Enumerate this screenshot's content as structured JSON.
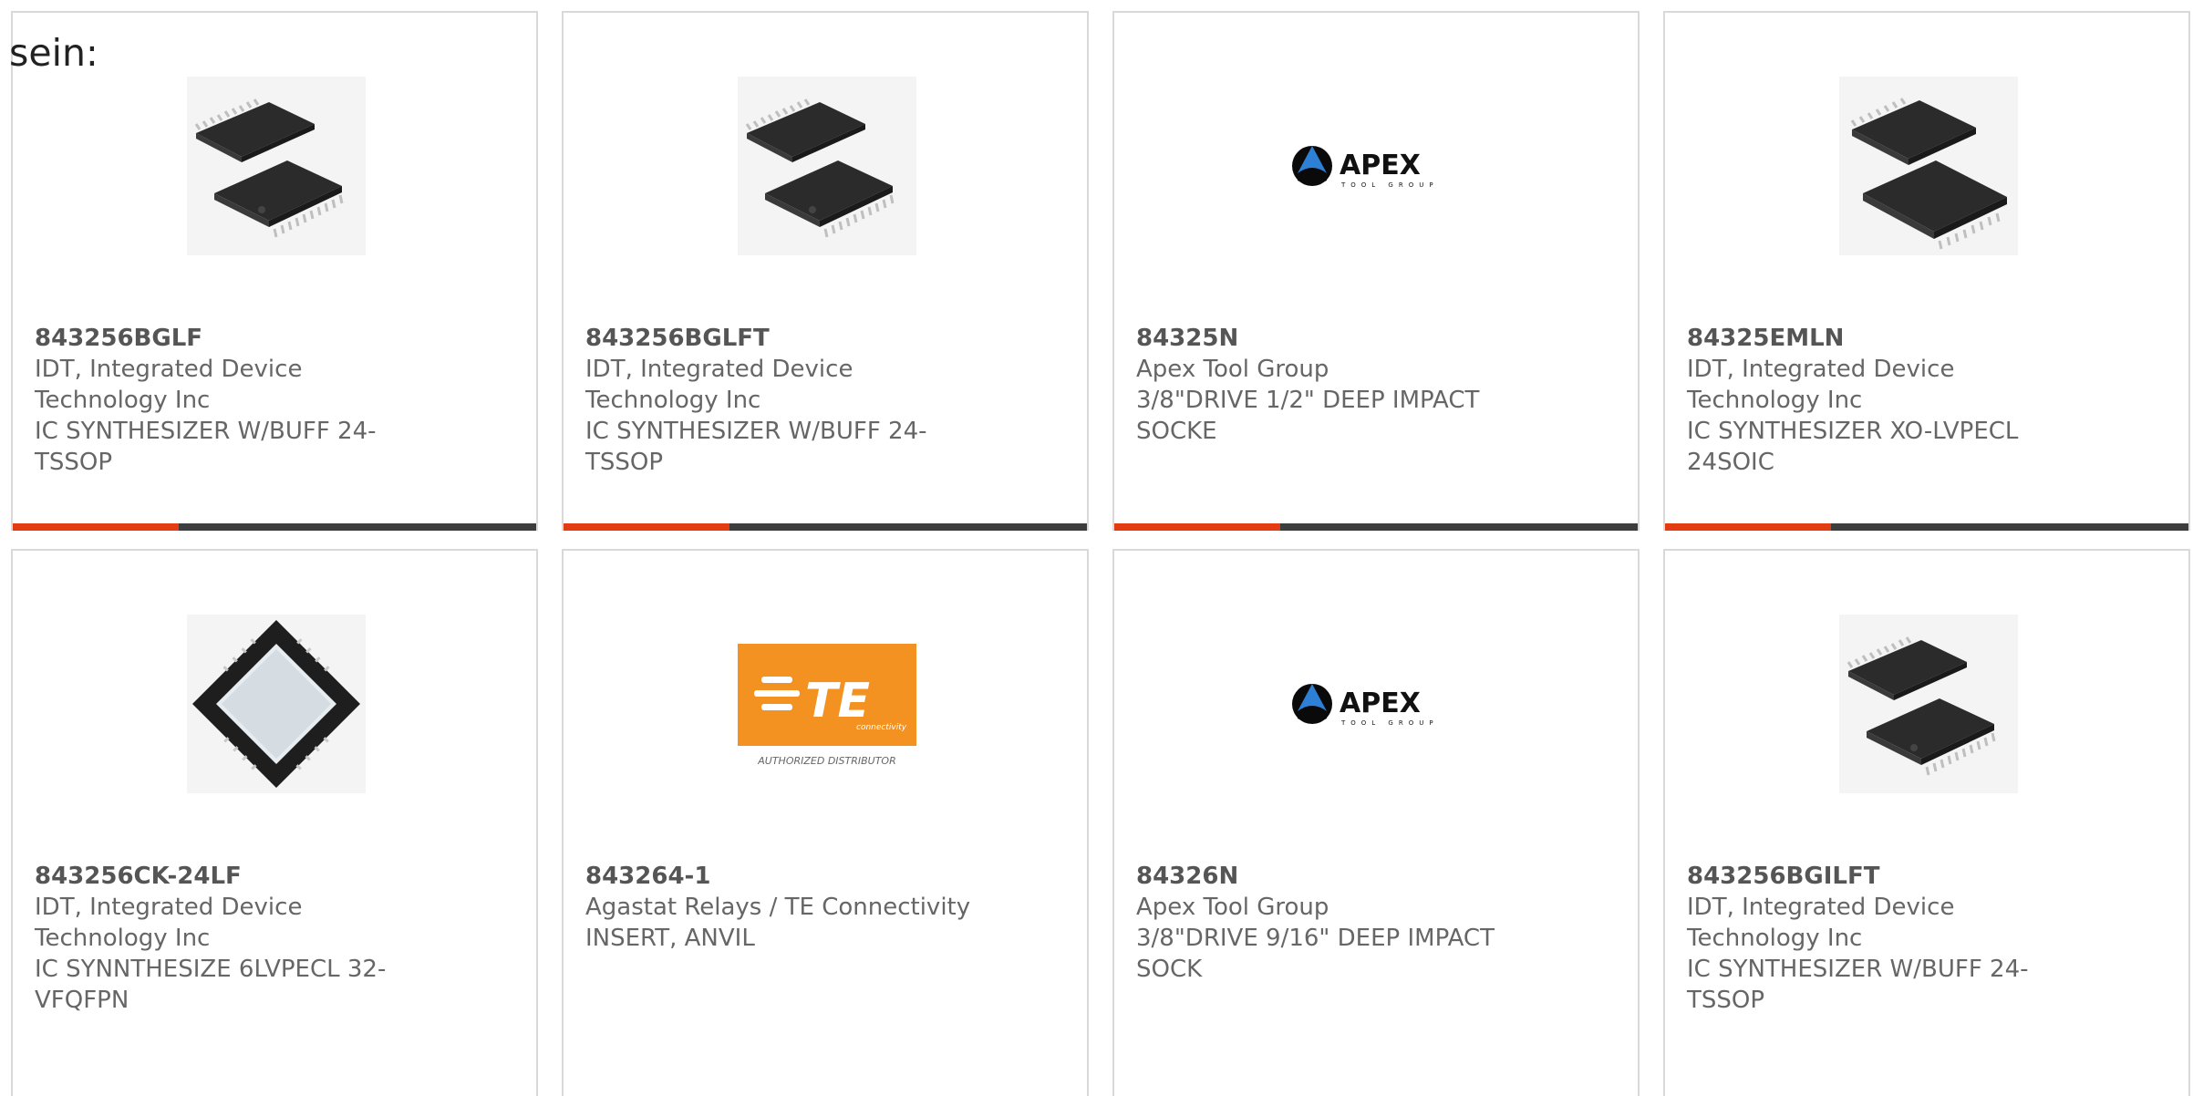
{
  "lead_text": "sein:",
  "products": [
    {
      "part_number": "843256BGLF",
      "manufacturer": "IDT, Integrated Device Technology Inc",
      "description": "IC SYNTHESIZER W/BUFF 24-TSSOP",
      "image": "tssop-chip-image",
      "manufacturer_lines": [
        "IDT, Integrated Device",
        "Technology Inc"
      ],
      "description_lines": [
        "IC SYNTHESIZER W/BUFF 24-",
        "TSSOP"
      ]
    },
    {
      "part_number": "843256BGLFT",
      "manufacturer": "IDT, Integrated Device Technology Inc",
      "description": "IC SYNTHESIZER W/BUFF 24-TSSOP",
      "image": "tssop-chip-image",
      "manufacturer_lines": [
        "IDT, Integrated Device",
        "Technology Inc"
      ],
      "description_lines": [
        "IC SYNTHESIZER W/BUFF 24-",
        "TSSOP"
      ]
    },
    {
      "part_number": "84325N",
      "manufacturer": "Apex Tool Group",
      "description": "3/8\"DRIVE 1/2\" DEEP IMPACT SOCKE",
      "image": "apex-logo",
      "manufacturer_lines": [
        "Apex Tool Group"
      ],
      "description_lines": [
        "3/8\"DRIVE 1/2\" DEEP IMPACT",
        "SOCKE"
      ]
    },
    {
      "part_number": "84325EMLN",
      "manufacturer": "IDT, Integrated Device Technology Inc",
      "description": "IC SYNTHESIZER XO-LVPECL 24SOIC",
      "image": "soic-chip-image",
      "manufacturer_lines": [
        "IDT, Integrated Device",
        "Technology Inc"
      ],
      "description_lines": [
        "IC SYNTHESIZER XO-LVPECL",
        "24SOIC"
      ]
    },
    {
      "part_number": "843256CK-24LF",
      "manufacturer": "IDT, Integrated Device Technology Inc",
      "description": "IC SYNNTHESIZE 6LVPECL 32-VFQFPN",
      "image": "qfn-chip-image",
      "manufacturer_lines": [
        "IDT, Integrated Device",
        "Technology Inc"
      ],
      "description_lines": [
        "IC SYNNTHESIZE 6LVPECL 32-",
        "VFQFPN"
      ]
    },
    {
      "part_number": "843264-1",
      "manufacturer": "Agastat Relays / TE Connectivity",
      "description": "INSERT, ANVIL",
      "image": "te-connectivity-logo",
      "manufacturer_lines": [
        "Agastat Relays / TE Connectivity"
      ],
      "description_lines": [
        "INSERT, ANVIL"
      ]
    },
    {
      "part_number": "84326N",
      "manufacturer": "Apex Tool Group",
      "description": "3/8\"DRIVE 9/16\" DEEP IMPACT SOCK",
      "image": "apex-logo",
      "manufacturer_lines": [
        "Apex Tool Group"
      ],
      "description_lines": [
        "3/8\"DRIVE 9/16\" DEEP IMPACT",
        "SOCK"
      ]
    },
    {
      "part_number": "843256BGILFT",
      "manufacturer": "IDT, Integrated Device Technology Inc",
      "description": "IC SYNTHESIZER W/BUFF 24-TSSOP",
      "image": "tssop-chip-image",
      "manufacturer_lines": [
        "IDT, Integrated Device",
        "Technology Inc"
      ],
      "description_lines": [
        "IC SYNTHESIZER W/BUFF 24-",
        "TSSOP"
      ]
    }
  ],
  "logos": {
    "apex_word": "APEX",
    "apex_sub": "TOOL GROUP",
    "te_word": "TE",
    "te_sub": "connectivity",
    "te_tagline": "AUTHORIZED DISTRIBUTOR"
  },
  "colors": {
    "accent": "#e33b12",
    "bar": "#3d3d3d",
    "te_orange": "#f39220",
    "chip": "#2b2b2b"
  }
}
